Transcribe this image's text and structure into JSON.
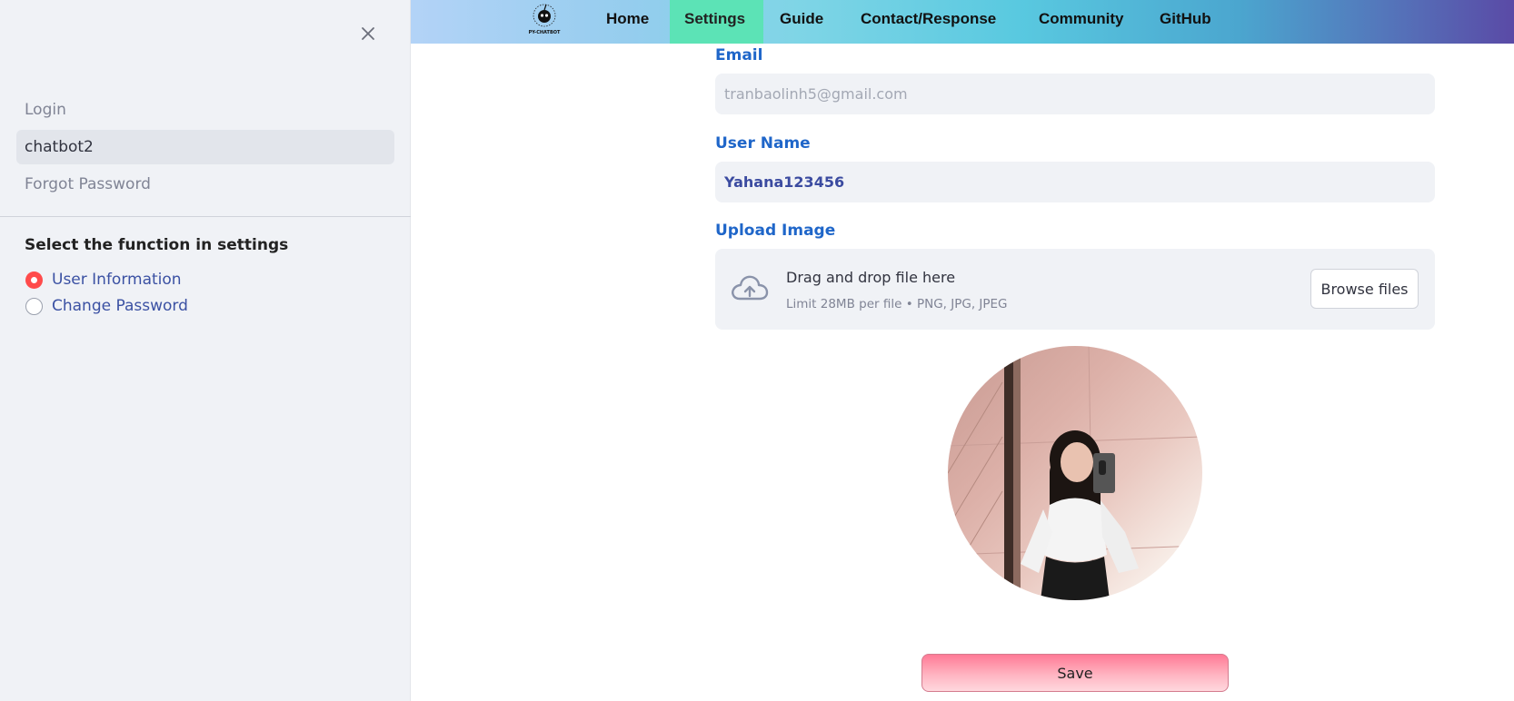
{
  "sidebar": {
    "nav_items": [
      {
        "label": "Login"
      },
      {
        "label": "chatbot2",
        "active": true
      },
      {
        "label": "Forgot Password"
      }
    ],
    "section_heading": "Select the function in settings",
    "radio_options": [
      {
        "label": "User Information",
        "selected": true
      },
      {
        "label": "Change Password",
        "selected": false
      }
    ]
  },
  "topnav": {
    "logo_text": "PY-CHATBOT",
    "items": [
      {
        "label": "Home"
      },
      {
        "label": "Settings",
        "active": true
      },
      {
        "label": "Guide"
      },
      {
        "label": "Contact/Response"
      },
      {
        "label": "Community"
      },
      {
        "label": "GitHub"
      }
    ]
  },
  "form": {
    "email_label": "Email",
    "email_placeholder": "tranbaolinh5@gmail.com",
    "username_label": "User Name",
    "username_value": "Yahana123456",
    "upload_label": "Upload Image",
    "upload_title": "Drag and drop file here",
    "upload_limit": "Limit 28MB per file • PNG, JPG, JPEG",
    "browse_label": "Browse files",
    "save_label": "Save"
  },
  "colors": {
    "accent_red": "#ff4b4b",
    "label_blue": "#1f66c9",
    "active_tab": "#5ce3b6"
  }
}
